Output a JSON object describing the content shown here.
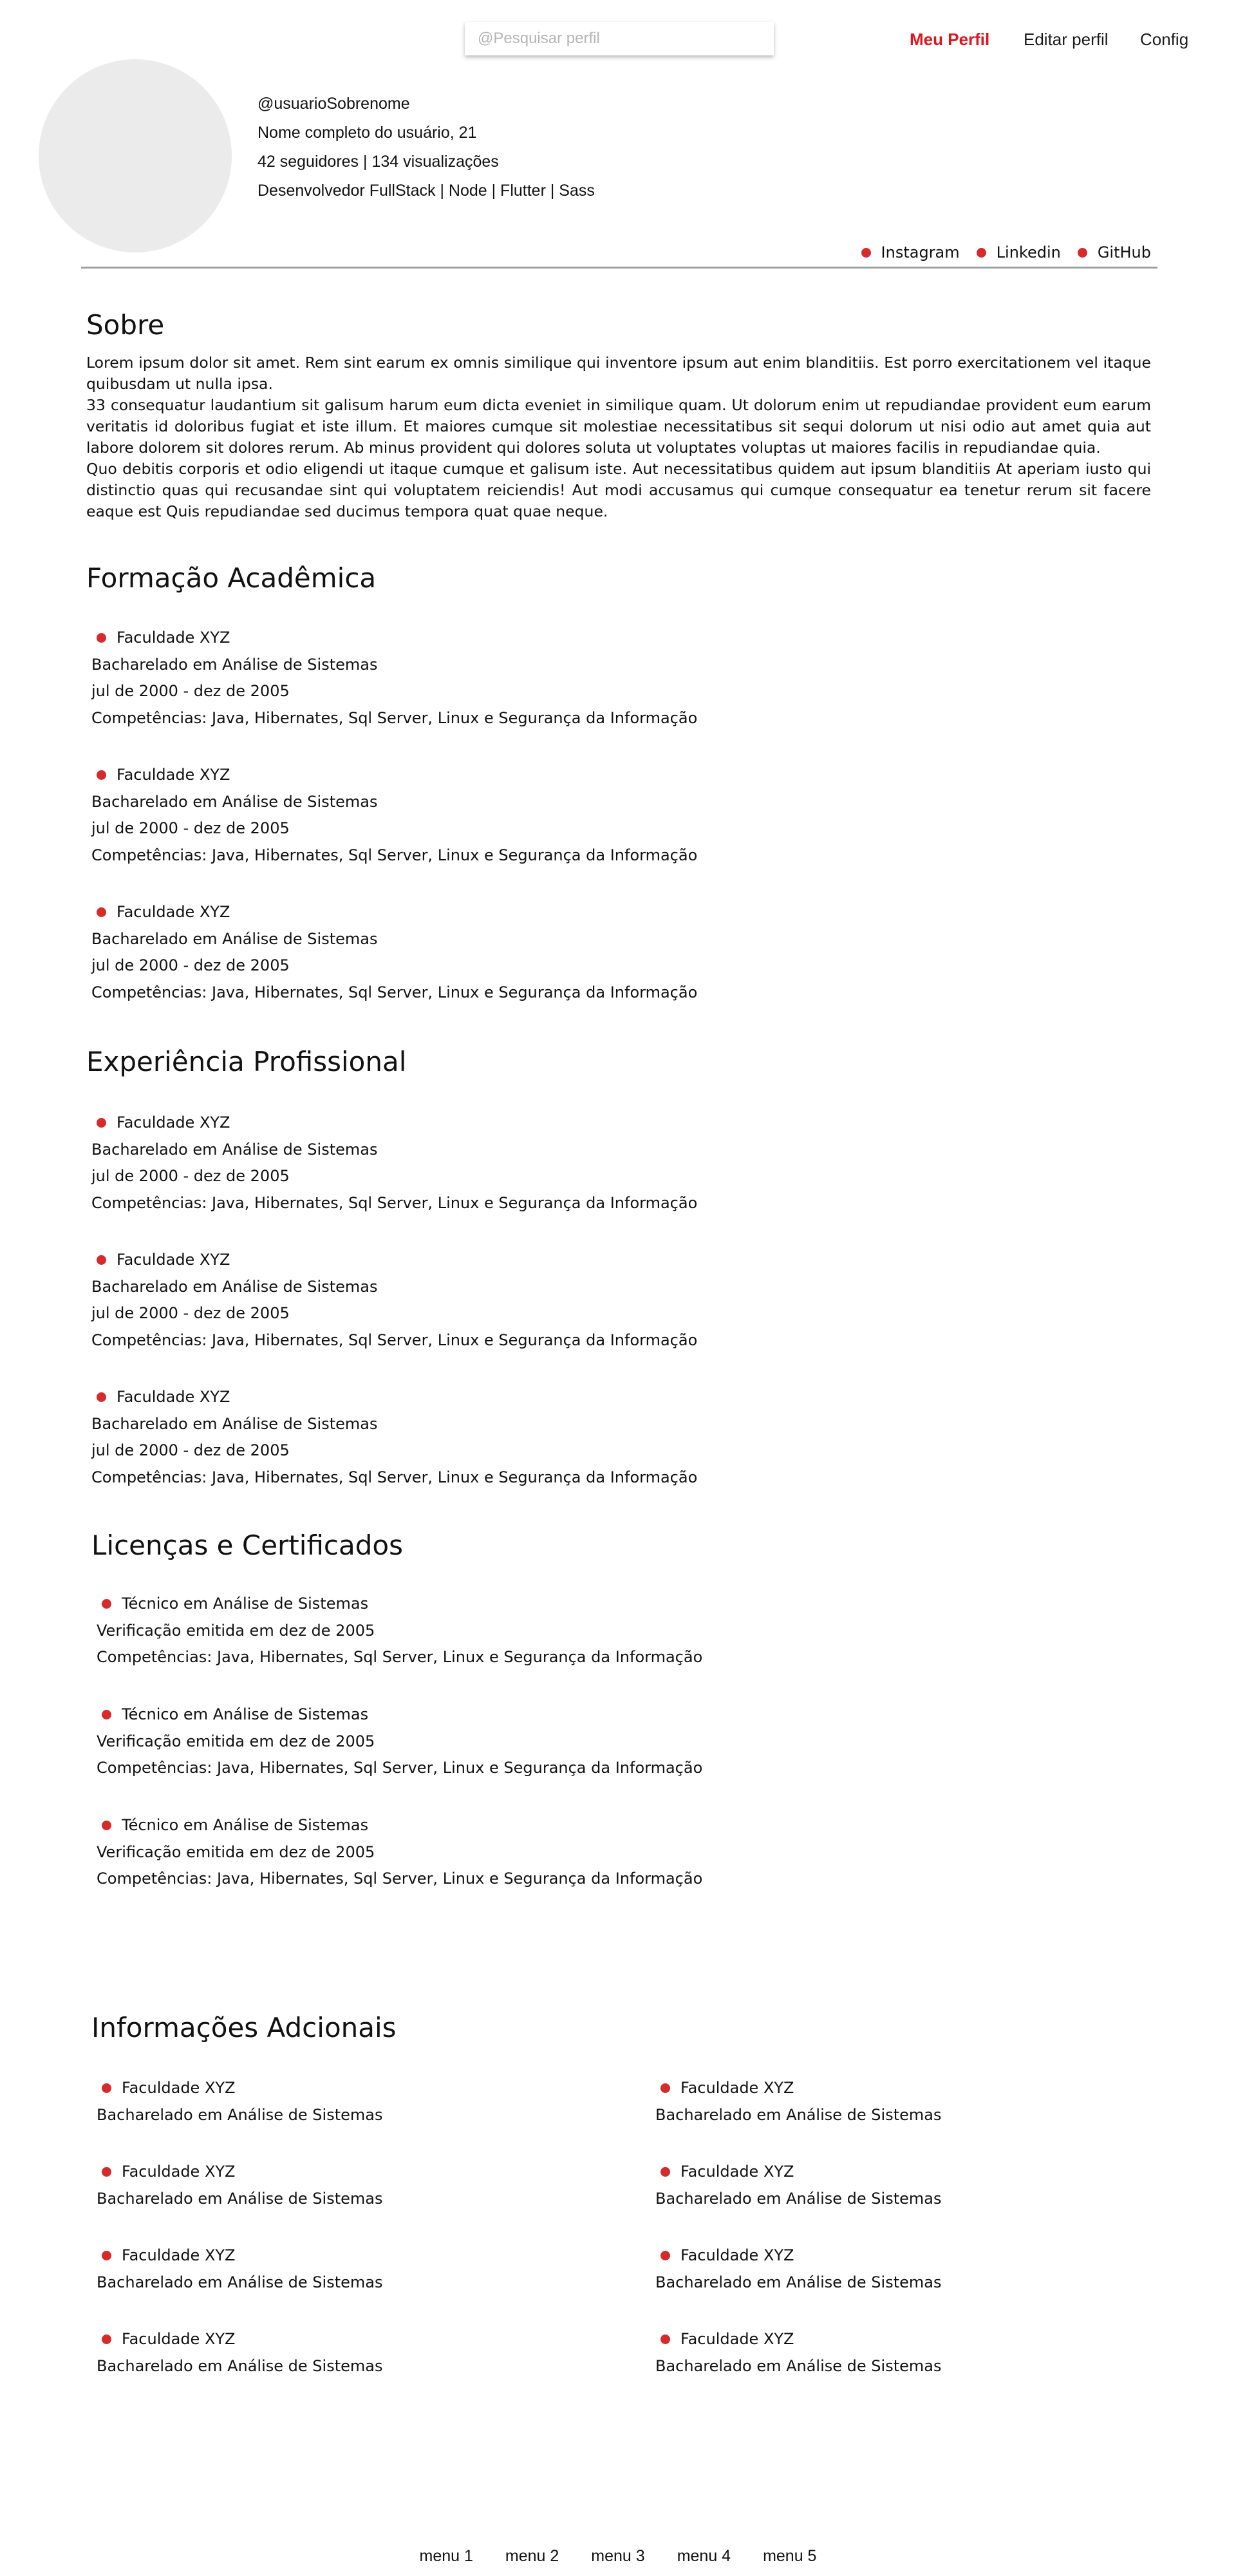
{
  "header": {
    "search_placeholder": "@Pesquisar perfil",
    "nav": [
      {
        "label": "Meu Perfil",
        "active": true
      },
      {
        "label": "Editar perfil",
        "active": false
      },
      {
        "label": "Config",
        "active": false
      }
    ],
    "accent_color": "#e0141e"
  },
  "profile": {
    "username": "@usuarioSobrenome",
    "name_age": "Nome completo do usuário, 21",
    "stats": "42 seguidores | 134 visualizações",
    "stack": "Desenvolvedor FullStack | Node | Flutter | Sass"
  },
  "socials": [
    "Instagram",
    "Linkedin",
    "GitHub"
  ],
  "about": {
    "title": "Sobre",
    "paragraphs": [
      "Lorem ipsum dolor sit amet. Rem sint earum ex omnis similique qui inventore ipsum aut enim blanditiis. Est porro exercitationem vel itaque quibusdam ut nulla ipsa.",
      "33 consequatur laudantium sit galisum harum eum dicta eveniet in similique quam. Ut dolorum enim ut repudiandae provident eum earum veritatis id doloribus fugiat et iste illum. Et maiores cumque sit molestiae necessitatibus sit sequi dolorum ut nisi odio aut amet quia aut labore dolorem sit dolores rerum. Ab minus provident qui dolores soluta ut voluptates voluptas ut maiores facilis in repudiandae quia.",
      "Quo debitis corporis et odio eligendi ut itaque cumque et galisum iste. Aut necessitatibus quidem aut ipsum blanditiis At aperiam iusto qui distinctio quas qui recusandae sint qui voluptatem reiciendis! Aut modi accusamus qui cumque consequatur ea tenetur rerum sit facere eaque est Quis repudiandae sed ducimus tempora quat quae neque."
    ]
  },
  "education": {
    "title": "Formação Acadêmica",
    "items": [
      {
        "institution": "Faculdade XYZ",
        "degree": "Bacharelado em Análise de Sistemas",
        "period": "jul de 2000 - dez de 2005",
        "skills": "Competências:  Java, Hibernates, Sql Server, Linux e Segurança da Informação"
      },
      {
        "institution": "Faculdade XYZ",
        "degree": "Bacharelado em Análise de Sistemas",
        "period": "jul de 2000 - dez de 2005",
        "skills": "Competências:  Java, Hibernates, Sql Server, Linux e Segurança da Informação"
      },
      {
        "institution": "Faculdade XYZ",
        "degree": "Bacharelado em Análise de Sistemas",
        "period": "jul de 2000 - dez de 2005",
        "skills": "Competências:  Java, Hibernates, Sql Server, Linux e Segurança da Informação"
      }
    ]
  },
  "experience": {
    "title": "Experiência Profissional",
    "items": [
      {
        "institution": "Faculdade XYZ",
        "degree": "Bacharelado em Análise de Sistemas",
        "period": "jul de 2000 - dez de 2005",
        "skills": "Competências:  Java, Hibernates, Sql Server, Linux e Segurança da Informação"
      },
      {
        "institution": "Faculdade XYZ",
        "degree": "Bacharelado em Análise de Sistemas",
        "period": "jul de 2000 - dez de 2005",
        "skills": "Competências:  Java, Hibernates, Sql Server, Linux e Segurança da Informação"
      },
      {
        "institution": "Faculdade XYZ",
        "degree": "Bacharelado em Análise de Sistemas",
        "period": "jul de 2000 - dez de 2005",
        "skills": "Competências:  Java, Hibernates, Sql Server, Linux e Segurança da Informação"
      }
    ]
  },
  "certificates": {
    "title": "Licenças e Certificados",
    "items": [
      {
        "name": "Técnico em Análise de Sistemas",
        "issued": "Verificação emitida em dez de 2005",
        "skills": "Competências:  Java, Hibernates, Sql Server, Linux e Segurança da Informação"
      },
      {
        "name": "Técnico em Análise de Sistemas",
        "issued": "Verificação emitida em dez de 2005",
        "skills": "Competências:  Java, Hibernates, Sql Server, Linux e Segurança da Informação"
      },
      {
        "name": "Técnico em Análise de Sistemas",
        "issued": "Verificação emitida em dez de 2005",
        "skills": "Competências:  Java, Hibernates, Sql Server, Linux e Segurança da Informação"
      }
    ]
  },
  "additional": {
    "title": "Informações Adcionais",
    "left": [
      {
        "institution": "Faculdade XYZ",
        "degree": "Bacharelado em Análise de Sistemas"
      },
      {
        "institution": "Faculdade XYZ",
        "degree": "Bacharelado em Análise de Sistemas"
      },
      {
        "institution": "Faculdade XYZ",
        "degree": "Bacharelado em Análise de Sistemas"
      },
      {
        "institution": "Faculdade XYZ",
        "degree": "Bacharelado em Análise de Sistemas"
      }
    ],
    "right": [
      {
        "institution": "Faculdade XYZ",
        "degree": "Bacharelado em Análise de Sistemas"
      },
      {
        "institution": "Faculdade XYZ",
        "degree": "Bacharelado em Análise de Sistemas"
      },
      {
        "institution": "Faculdade XYZ",
        "degree": "Bacharelado em Análise de Sistemas"
      },
      {
        "institution": "Faculdade XYZ",
        "degree": "Bacharelado em Análise de Sistemas"
      }
    ]
  },
  "footer": {
    "menu": [
      "menu 1",
      "menu 2",
      "menu 3",
      "menu 4",
      "menu 5"
    ]
  },
  "colors": {
    "bullet": "#d62b2b",
    "avatar_bg": "#ebebeb",
    "divider": "#a0a0a0"
  }
}
